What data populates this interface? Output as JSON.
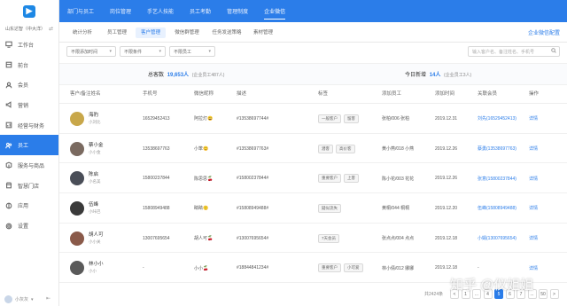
{
  "sidebar": {
    "org": "山东达智（中大洋）",
    "items": [
      {
        "label": "工作台",
        "icon": "monitor-icon"
      },
      {
        "label": "前台",
        "icon": "desk-icon"
      },
      {
        "label": "会员",
        "icon": "member-icon"
      },
      {
        "label": "营销",
        "icon": "megaphone-icon"
      },
      {
        "label": "经营与财务",
        "icon": "finance-icon"
      },
      {
        "label": "员工",
        "icon": "staff-icon"
      },
      {
        "label": "服务与商品",
        "icon": "box-icon"
      },
      {
        "label": "智慧门店",
        "icon": "store-icon"
      },
      {
        "label": "应用",
        "icon": "apps-icon"
      },
      {
        "label": "设置",
        "icon": "gear-icon"
      }
    ],
    "active_index": 5,
    "user": "小灰灰"
  },
  "topnav": {
    "tabs": [
      "部门与员工",
      "岗位管理",
      "手艺人技能",
      "员工考勤",
      "管理制度",
      "企业微信"
    ],
    "active_index": 5
  },
  "subtabs": {
    "items": [
      "统计分析",
      "员工管理",
      "客户管理",
      "微信群管理",
      "任务发送策略",
      "素材管理"
    ],
    "active_index": 2,
    "sync_link": "企业微信配置"
  },
  "filters": {
    "time": "不限添加时间",
    "condition": "不限条件",
    "staff": "不限员工",
    "search_placeholder": "输入客户名、备注姓名、手机号"
  },
  "stats": {
    "total_label": "总客数",
    "total_value": "19,653人",
    "total_sub": "(企业员工487人)",
    "today_label": "今日新增",
    "today_value": "14人",
    "today_sub": "(企业员工3人)"
  },
  "table": {
    "columns": [
      "客户/备注姓名",
      "手机号",
      "微信昵称",
      "描述",
      "标签",
      "添加员工",
      "添加时间",
      "关联会员",
      "操作"
    ],
    "rows": [
      {
        "name": "海豹",
        "alias": "小刘比",
        "phone": "16529452413",
        "wechat": "阿拉灯😄",
        "desc": "#13538697744#",
        "tags": [
          "一般客户",
          "留客"
        ],
        "staff": "张柏/006 张柏",
        "time": "2019.12.31",
        "member": "刘先(16529452413)",
        "action": "详情",
        "avatar_color": "#c8a74a"
      },
      {
        "name": "蔡小金",
        "alias": "小小金",
        "phone": "13538697763",
        "wechat": "小笨😊",
        "desc": "#13538697763#",
        "tags": [
          "潜客",
          "高价客"
        ],
        "staff": "黄小燕/018 小燕",
        "time": "2019.12.26",
        "member": "蔡勇(13538697763)",
        "action": "详情",
        "avatar_color": "#7a6a60"
      },
      {
        "name": "陈启",
        "alias": "小名美",
        "phone": "15800237844",
        "wechat": "陈思思🍒",
        "desc": "#15800237844#",
        "tags": [
          "重要客户",
          "上客"
        ],
        "staff": "陈小花/003 花花",
        "time": "2019.12.26",
        "member": "张意(15800237844)",
        "action": "详情",
        "avatar_color": "#4a4e58"
      },
      {
        "name": "伍峰",
        "alias": "小咔巴",
        "phone": "15808949488",
        "wechat": "睛睛🙂",
        "desc": "#15808949488#",
        "tags": [
          "疑似流失"
        ],
        "staff": "黄桐/044 桐桐",
        "time": "2019.12.20",
        "member": "伍峰(15808949488)",
        "action": "详情",
        "avatar_color": "#3a3a3a"
      },
      {
        "name": "胡人可",
        "alias": "小小关",
        "phone": "13007695654",
        "wechat": "胡人可🍒",
        "desc": "#13007695654#",
        "tags": [
          "7天会员"
        ],
        "staff": "张点点/004 点点",
        "time": "2019.12.18",
        "member": "小娟(13007695654)",
        "action": "详情",
        "avatar_color": "#8a5a4a"
      },
      {
        "name": "林小小",
        "alias": "小小",
        "phone": "-",
        "wechat": "小小🍒",
        "desc": "#18844841234#",
        "tags": [
          "重要客户",
          "小可爱"
        ],
        "staff": "林小倩/012 娜娜",
        "time": "2019.12.18",
        "member": "-",
        "action": "详情",
        "avatar_color": "#5a5a5a"
      }
    ]
  },
  "pagination": {
    "total": "共2424条",
    "pages": [
      "<",
      "1",
      "...",
      "4",
      "5",
      "6",
      "7",
      "...",
      "50",
      ">"
    ],
    "active": "5"
  },
  "watermark": "知乎 @仪姐姐"
}
